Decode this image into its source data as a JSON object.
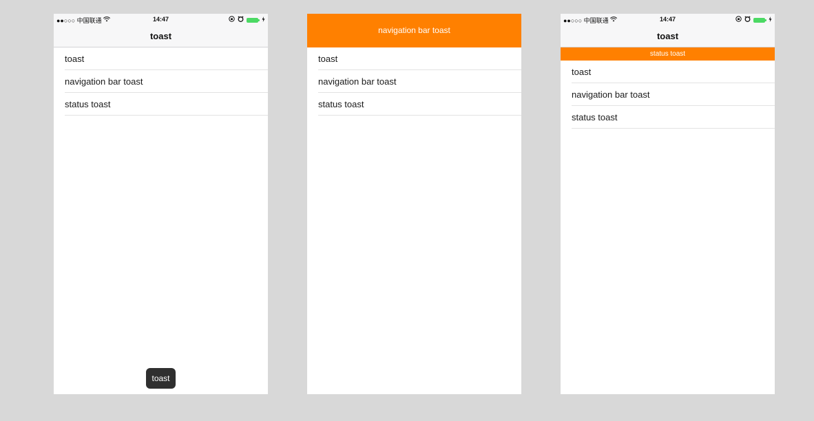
{
  "status_bar": {
    "carrier": "●●○○○ 中国联通",
    "wifi_icon": "wifi-icon",
    "time": "14:47",
    "lock_icon": "orientation-lock-icon",
    "alarm_icon": "alarm-icon",
    "battery_color": "#4cd964"
  },
  "phone1": {
    "nav_title": "toast",
    "list": [
      "toast",
      "navigation bar toast",
      "status toast"
    ],
    "toast_text": "toast"
  },
  "phone2": {
    "nav_toast_text": "navigation bar toast",
    "list": [
      "toast",
      "navigation bar toast",
      "status toast"
    ]
  },
  "phone3": {
    "nav_title": "toast",
    "status_toast_text": "status toast",
    "list": [
      "toast",
      "navigation bar toast",
      "status toast"
    ]
  },
  "colors": {
    "toast_orange": "#ff8000",
    "toast_dark": "#2f2f2f",
    "background": "#d8d8d8"
  }
}
